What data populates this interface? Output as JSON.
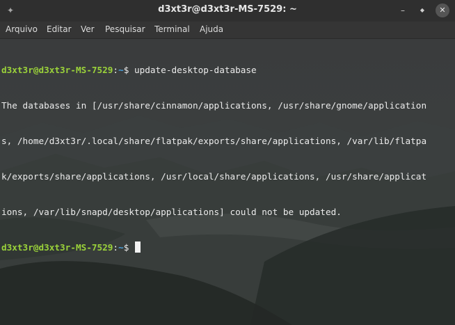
{
  "window": {
    "title": "d3xt3r@d3xt3r-MS-7529: ~",
    "pin_icon": "pin-icon",
    "buttons": {
      "minimize": "–",
      "maximize": "◆",
      "close": "✕"
    }
  },
  "menu": {
    "items": [
      "Arquivo",
      "Editar",
      "Ver",
      "Pesquisar",
      "Terminal",
      "Ajuda"
    ]
  },
  "terminal": {
    "prompt_user_host": "d3xt3r@d3xt3r-MS-7529",
    "prompt_sep": ":",
    "prompt_path": "~",
    "prompt_dollar": "$ ",
    "command": "update-desktop-database",
    "output_lines": [
      "The databases in [/usr/share/cinnamon/applications, /usr/share/gnome/application",
      "s, /home/d3xt3r/.local/share/flatpak/exports/share/applications, /var/lib/flatpa",
      "k/exports/share/applications, /usr/local/share/applications, /usr/share/applicat",
      "ions, /var/lib/snapd/desktop/applications] could not be updated."
    ]
  },
  "colors": {
    "prompt_user": "#9bd33a",
    "prompt_path": "#4aa3e0",
    "text": "#ececec"
  }
}
